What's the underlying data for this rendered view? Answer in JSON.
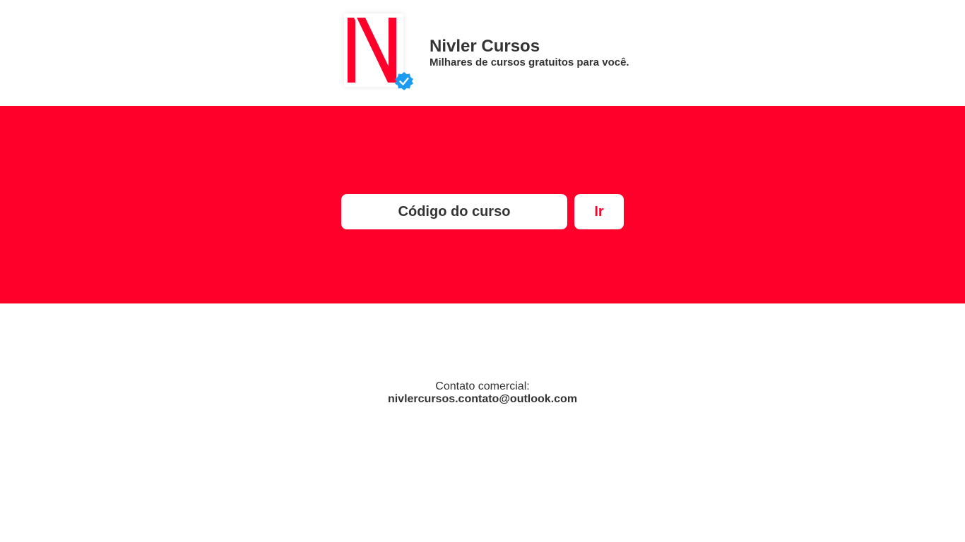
{
  "header": {
    "title": "Nivler Cursos",
    "subtitle": "Milhares de cursos gratuitos para você.",
    "logo_icon": "nivler-n-logo",
    "verified_icon": "verified-badge-icon"
  },
  "search": {
    "placeholder": "Código do curso",
    "value": "",
    "button_label": "Ir"
  },
  "contact": {
    "label": "Contato comercial:",
    "email": "nivlercursos.contato@outlook.com"
  },
  "colors": {
    "brand_red": "#ff002b",
    "verified_blue": "#1d9bf0",
    "text": "#333333",
    "background": "#ffffff"
  }
}
